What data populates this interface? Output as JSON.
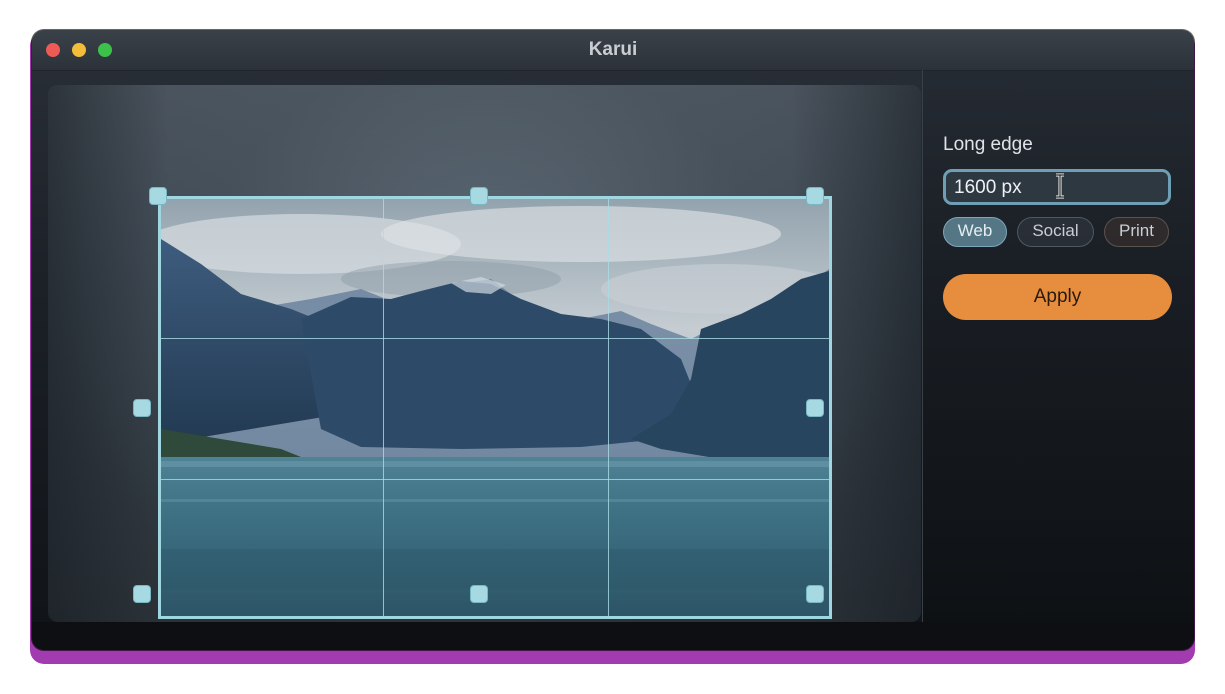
{
  "window": {
    "title": "Karui"
  },
  "sidebar": {
    "long_edge_label": "Long edge",
    "long_edge_value": "1600 px",
    "presets": [
      "Web",
      "Social",
      "Print"
    ],
    "selected_preset": "Web",
    "apply_label": "Apply"
  },
  "colors": {
    "accent": "#e78e3e",
    "crop_frame": "#9fd6e0",
    "selected_preset": "#557684"
  },
  "icons": {
    "text_cursor": "i-beam-cursor-icon"
  }
}
